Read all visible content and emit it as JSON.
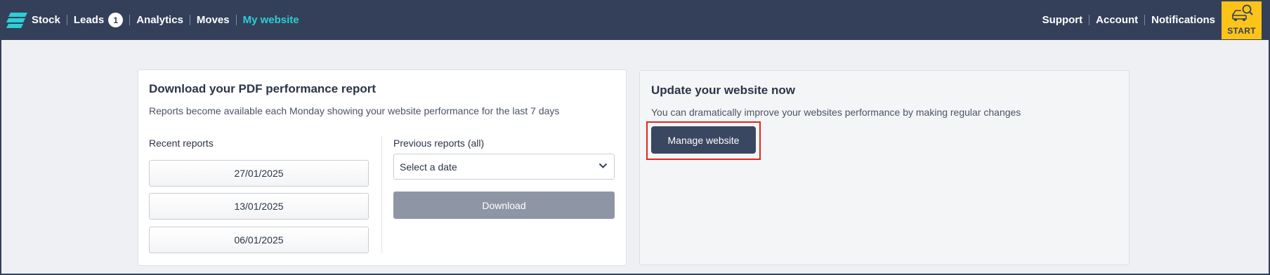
{
  "nav": {
    "items": [
      {
        "label": "Stock"
      },
      {
        "label": "Leads",
        "badge": "1"
      },
      {
        "label": "Analytics"
      },
      {
        "label": "Moves"
      },
      {
        "label": "My website"
      }
    ],
    "right": [
      "Support",
      "Account",
      "Notifications"
    ],
    "start_label": "START"
  },
  "report_card": {
    "title": "Download your PDF performance report",
    "description": "Reports become available each Monday showing your website performance for the last 7 days",
    "recent_label": "Recent reports",
    "recent_reports": [
      "27/01/2025",
      "13/01/2025",
      "06/01/2025"
    ],
    "previous_label": "Previous reports (all)",
    "select_value": "Select a date",
    "download_label": "Download"
  },
  "update_card": {
    "title": "Update your website now",
    "description": "You can dramatically improve your websites performance by making regular changes",
    "button_label": "Manage website"
  },
  "colors": {
    "nav_bg": "#34405a",
    "active_nav": "#2ccfd4",
    "start_bg": "#fcc419",
    "highlight": "#e4261c"
  }
}
